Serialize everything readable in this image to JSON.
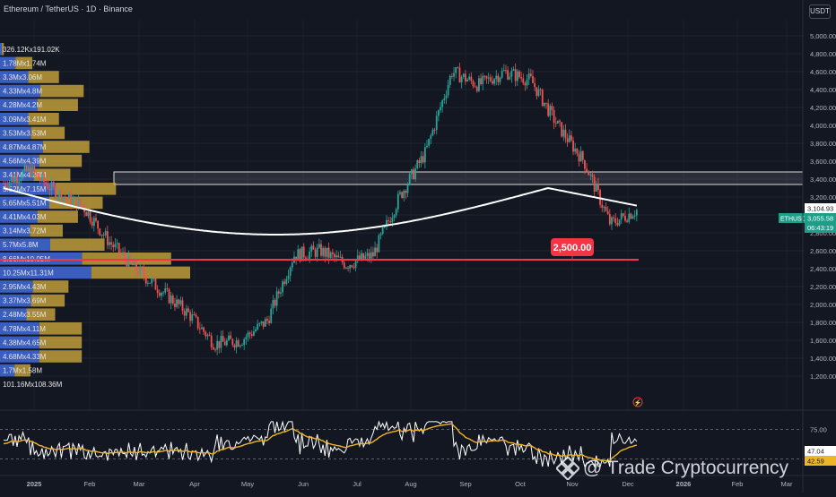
{
  "header": {
    "symbol_title": "Ethereum / TetherUS · 1D · Binance",
    "currency_button": "USDT"
  },
  "price_axis": {
    "labels": [
      "5,000.00",
      "4,800.00",
      "4,600.00",
      "4,400.00",
      "4,200.00",
      "4,000.00",
      "3,800.00",
      "3,600.00",
      "3,400.00",
      "3,200.00",
      "3,000.00",
      "2,800.00",
      "2,600.00",
      "2,400.00",
      "2,200.00",
      "2,000.00",
      "1,800.00",
      "1,600.00",
      "1,400.00",
      "1,200.00"
    ],
    "ma_value": "3,104.93",
    "symbol_tag": "ETHUSDT",
    "last_price": "3,055.58",
    "countdown": "06:43:19"
  },
  "time_axis": {
    "labels": [
      "2025",
      "Feb",
      "Mar",
      "Apr",
      "May",
      "Jun",
      "Jul",
      "Aug",
      "Sep",
      "Oct",
      "Nov",
      "Dec",
      "2026",
      "Feb",
      "Mar"
    ]
  },
  "volume_profile": {
    "rows": [
      {
        "label": "326.12Kx191.02K",
        "width": 0.02
      },
      {
        "label": "1.78Mx1.74M",
        "width": 0.17
      },
      {
        "label": "3.3Mx3.06M",
        "width": 0.31
      },
      {
        "label": "4.33Mx4.8M",
        "width": 0.44
      },
      {
        "label": "4.28Mx4.2M",
        "width": 0.41
      },
      {
        "label": "3.09Mx3.41M",
        "width": 0.31
      },
      {
        "label": "3.53Mx3.53M",
        "width": 0.34
      },
      {
        "label": "4.87Mx4.87M",
        "width": 0.47
      },
      {
        "label": "4.56Mx4.39M",
        "width": 0.43
      },
      {
        "label": "3.41Mx4.28M",
        "width": 0.37
      },
      {
        "label": "5.52Mx7.15M",
        "width": 0.61
      },
      {
        "label": "5.65Mx5.51M",
        "width": 0.54
      },
      {
        "label": "4.41Mx4.03M",
        "width": 0.41
      },
      {
        "label": "3.14Mx3.72M",
        "width": 0.33
      },
      {
        "label": "5.7Mx5.8M",
        "width": 0.55
      },
      {
        "label": "8.66Mx10.05M",
        "width": 0.9
      },
      {
        "label": "10.25Mx11.31M",
        "width": 1.0
      },
      {
        "label": "2.95Mx4.43M",
        "width": 0.36
      },
      {
        "label": "3.37Mx3.69M",
        "width": 0.34
      },
      {
        "label": "2.48Mx3.55M",
        "width": 0.29
      },
      {
        "label": "4.78Mx4.11M",
        "width": 0.43
      },
      {
        "label": "4.38Mx4.65M",
        "width": 0.43
      },
      {
        "label": "4.68Mx4.33M",
        "width": 0.43
      },
      {
        "label": "1.7Mx1.58M",
        "width": 0.16
      },
      {
        "label": "101.16Mx108.36M",
        "width": 0
      }
    ]
  },
  "annotations": {
    "support_label": "2,500.00",
    "support_level": 2500,
    "resistance_zone": [
      3340,
      3480
    ]
  },
  "rsi": {
    "labels": [
      "75.00",
      "47.04",
      "42.59"
    ]
  },
  "watermark": "@ Trade Cryptocurrency",
  "colors": {
    "background": "#131722",
    "up": "#26a69a",
    "down": "#ef5350",
    "ma_line": "#ffffff",
    "volume_buy": "#3c62c8",
    "volume_sell": "#c9a53b",
    "support_line": "#f23645",
    "rsi_line": "#ffffff",
    "rsi_ma": "#f0b429",
    "last_price_tag": "#1e9e8a"
  },
  "chart_data": {
    "type": "candlestick",
    "title": "Ethereum / TetherUS · 1D · Binance",
    "y_range": [
      1100,
      5100
    ],
    "y_ticks": [
      5000,
      4800,
      4600,
      4400,
      4200,
      4000,
      3800,
      3600,
      3400,
      3200,
      3000,
      2800,
      2600,
      2400,
      2200,
      2000,
      1800,
      1600,
      1400,
      1200
    ],
    "x_ticks": [
      "2025",
      "Feb",
      "Mar",
      "Apr",
      "May",
      "Jun",
      "Jul",
      "Aug",
      "Sep",
      "Oct",
      "Nov",
      "Dec",
      "2026",
      "Feb",
      "Mar"
    ],
    "close_path": [
      {
        "m": "2025",
        "v": 3350
      },
      {
        "m": "2025+",
        "v": 3500
      },
      {
        "m": "Jan",
        "v": 3250
      },
      {
        "m": "Feb",
        "v": 3100
      },
      {
        "m": "Feb+",
        "v": 2700
      },
      {
        "m": "Feb++",
        "v": 2400
      },
      {
        "m": "Mar",
        "v": 2150
      },
      {
        "m": "Mar+",
        "v": 1900
      },
      {
        "m": "Apr",
        "v": 1560
      },
      {
        "m": "Apr+",
        "v": 1600
      },
      {
        "m": "May",
        "v": 1820
      },
      {
        "m": "May+",
        "v": 2550
      },
      {
        "m": "Jun",
        "v": 2600
      },
      {
        "m": "Jun+",
        "v": 2450
      },
      {
        "m": "Jul",
        "v": 2550
      },
      {
        "m": "Jul+",
        "v": 3200
      },
      {
        "m": "Aug",
        "v": 3700
      },
      {
        "m": "Aug+",
        "v": 4600
      },
      {
        "m": "Sep",
        "v": 4450
      },
      {
        "m": "Sep+",
        "v": 4600
      },
      {
        "m": "Oct",
        "v": 4500
      },
      {
        "m": "Oct+",
        "v": 4000
      },
      {
        "m": "Nov",
        "v": 3600
      },
      {
        "m": "Nov+",
        "v": 2900
      },
      {
        "m": "Dec",
        "v": 3055
      }
    ],
    "moving_average": {
      "last": 3104.93
    },
    "horizontal_line": 2500,
    "resistance_zone": [
      3340,
      3480
    ],
    "last_price": 3055.58
  }
}
